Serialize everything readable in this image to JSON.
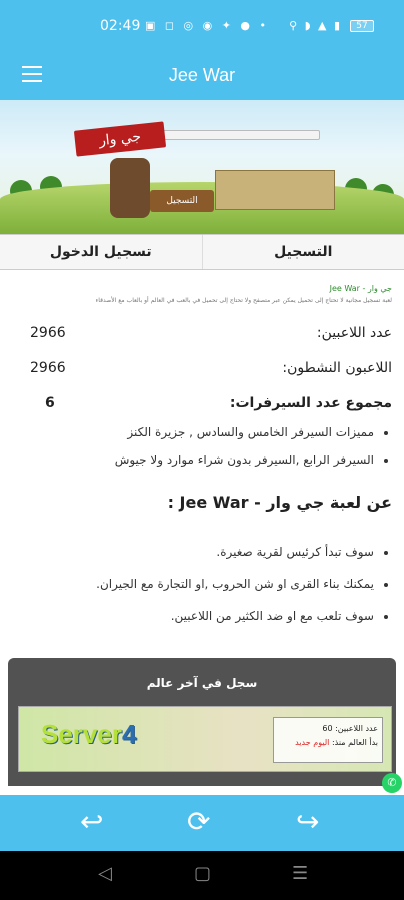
{
  "status": {
    "time": "02:49",
    "battery": "57"
  },
  "appbar": {
    "title": "Jee War"
  },
  "banner": {
    "logo_text": "جي وار",
    "sign_text": "التسجيل"
  },
  "tabs": {
    "register": "التسجيل",
    "login": "تسجيل الدخول"
  },
  "content": {
    "breadcrumb": "جي وار - Jee War",
    "tiny_line": "لعبة تسجيل مجانية لا تحتاج إلى تحميل يمكن عبر متصفح ولا تحتاج إلى تحميل في بالعب في العالم أو بالعاب مع الأصدقاء",
    "stats": [
      {
        "label": "عدد اللاعبين:",
        "value": "2966"
      },
      {
        "label": "اللاعبون النشطون:",
        "value": "2966"
      },
      {
        "label": "مجموع عدد السيرفرات:",
        "value": "6"
      }
    ],
    "servers_list": [
      "مميزات السيرفر الخامس والسادس , جزيرة الكنز",
      "السيرفر الرابع ,السيرفر بدون شراء موارد ولا جيوش"
    ],
    "about_title": "عن لعبة جي وار - Jee War :",
    "about_list": [
      "سوف تبدأ كرئيس لقرية صغيرة.",
      "يمكنك بناء القرى او شن الحروب ,او التجارة مع الجيران.",
      "سوف تلعب مع او ضد الكثير من اللاعبين."
    ]
  },
  "card": {
    "title": "سجل في آخر عالم",
    "server_text": "Server",
    "server_number": "4",
    "players_label": "عدد اللاعبين: 60",
    "started_label": "بدأ العالم منذ:",
    "started_value": "اليوم جديد"
  }
}
